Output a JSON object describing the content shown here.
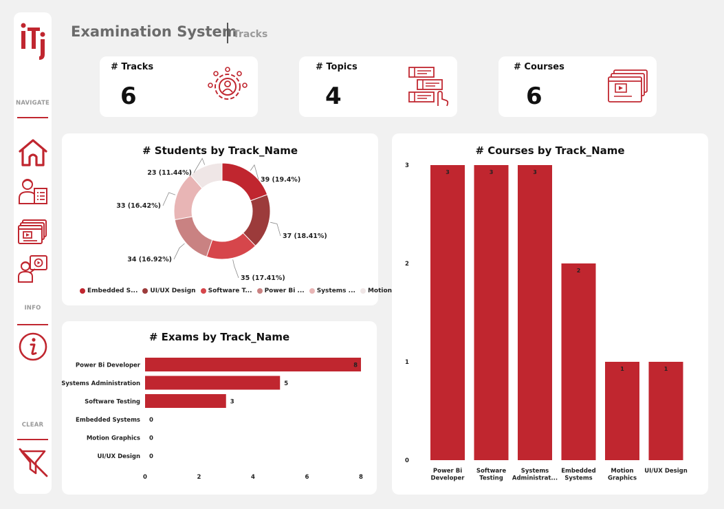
{
  "header": {
    "title": "Examination System",
    "subtitle": "Tracks"
  },
  "sidebar": {
    "sections": [
      {
        "label": "NAVIGATE"
      },
      {
        "label": "INFO"
      },
      {
        "label": "CLEAR"
      }
    ],
    "icons": [
      "home-icon",
      "student-report-icon",
      "courses-icon",
      "instructor-icon",
      "info-icon",
      "clear-filter-icon"
    ]
  },
  "kpis": [
    {
      "label": "# Tracks",
      "value": "6",
      "icon": "team-gear-icon"
    },
    {
      "label": "# Topics",
      "value": "4",
      "icon": "topic-list-icon"
    },
    {
      "label": "# Courses",
      "value": "6",
      "icon": "video-course-icon"
    }
  ],
  "colors": {
    "accent": "#c0262f",
    "card": "#ffffff",
    "background": "#f1f1f1"
  },
  "chart_data": [
    {
      "type": "pie",
      "title": "# Students by Track_Name",
      "categories": [
        "Embedded Systems",
        "UI/UX Design",
        "Software Testing",
        "Power Bi Developer",
        "Systems Administration",
        "Motion Graphics"
      ],
      "legend_labels": [
        "Embedded S...",
        "UI/UX Design",
        "Software T...",
        "Power Bi ...",
        "Systems ...",
        "Motion ..."
      ],
      "values": [
        39,
        37,
        35,
        34,
        33,
        23
      ],
      "data_labels": [
        "39 (19.4%)",
        "37 (18.41%)",
        "35 (17.41%)",
        "34 (16.92%)",
        "33 (16.42%)",
        "23 (11.44%)"
      ],
      "colors": [
        "#c0262f",
        "#9c3b3b",
        "#d6464b",
        "#c98282",
        "#e8b5b5",
        "#efe6e6"
      ],
      "legend": "bottom"
    },
    {
      "type": "bar",
      "orientation": "horizontal",
      "title": "# Exams by Track_Name",
      "categories": [
        "Power Bi Developer",
        "Systems Administration",
        "Software Testing",
        "Embedded Systems",
        "Motion Graphics",
        "UI/UX Design"
      ],
      "values": [
        8,
        5,
        3,
        0,
        0,
        0
      ],
      "xlim": [
        0,
        8
      ],
      "xticks": [
        "0",
        "2",
        "4",
        "6",
        "8"
      ],
      "color": "#c0262f"
    },
    {
      "type": "bar",
      "title": "# Courses by Track_Name",
      "categories": [
        "Power Bi Developer",
        "Software Testing",
        "Systems Administrat...",
        "Embedded Systems",
        "Motion Graphics",
        "UI/UX Design"
      ],
      "values": [
        3,
        3,
        3,
        2,
        1,
        1
      ],
      "ylim": [
        0,
        3
      ],
      "yticks": [
        "0",
        "1",
        "2",
        "3"
      ],
      "color": "#c0262f"
    }
  ]
}
